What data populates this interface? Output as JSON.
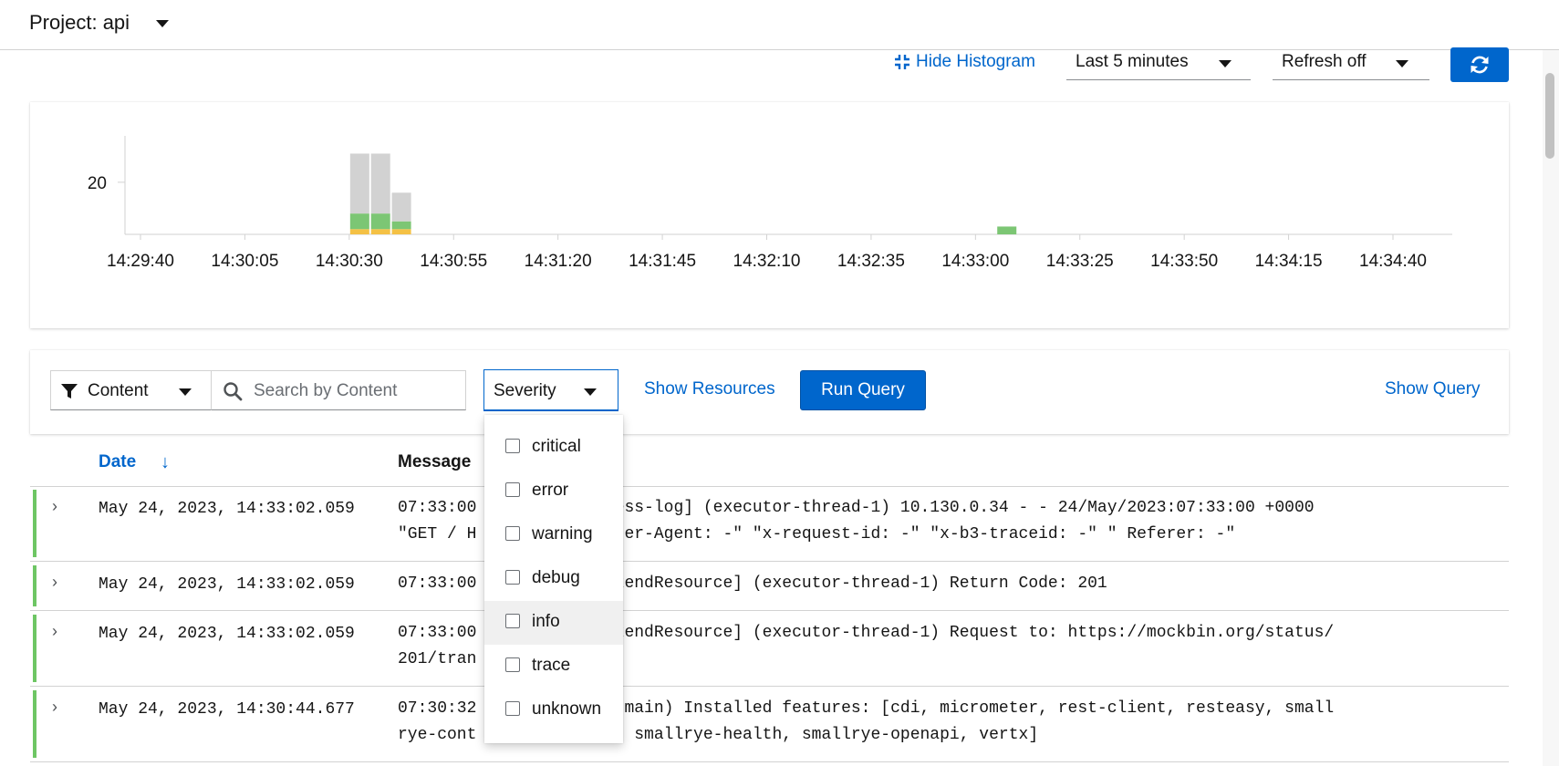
{
  "header": {
    "project_label": "Project: api"
  },
  "toolbar": {
    "hide_histogram_label": "Hide Histogram",
    "time_range_value": "Last 5 minutes",
    "refresh_value": "Refresh off",
    "refresh_icon": "sync-icon"
  },
  "chart_data": {
    "type": "bar",
    "stacked": true,
    "categories": [
      "14:30:30",
      "14:30:35",
      "14:30:40",
      "14:33:05"
    ],
    "series": [
      {
        "name": "",
        "color": "#f4c145",
        "values": [
          2,
          2,
          2,
          0
        ]
      },
      {
        "name": "",
        "color": "#7cc674",
        "values": [
          6,
          6,
          3,
          3
        ]
      },
      {
        "name": "",
        "color": "#d2d2d2",
        "values": [
          23,
          23,
          11,
          0
        ]
      }
    ],
    "y_ticks": [
      20
    ],
    "ylim": [
      0,
      35
    ],
    "x_ticks": [
      "14:29:40",
      "14:30:05",
      "14:30:30",
      "14:30:55",
      "14:31:20",
      "14:31:45",
      "14:32:10",
      "14:32:35",
      "14:33:00",
      "14:33:25",
      "14:33:50",
      "14:34:15",
      "14:34:40"
    ],
    "xlabel": "",
    "ylabel": "",
    "title": ""
  },
  "filter": {
    "attribute_value": "Content",
    "search_placeholder": "Search by Content",
    "severity_label": "Severity",
    "show_resources_label": "Show Resources",
    "run_query_label": "Run Query",
    "show_query_label": "Show Query"
  },
  "severity_options": [
    "critical",
    "error",
    "warning",
    "debug",
    "info",
    "trace",
    "unknown"
  ],
  "table": {
    "headers": {
      "date": "Date",
      "message": "Message"
    },
    "rows": [
      {
        "date": "May 24, 2023, 14:33:02.059",
        "message": "07:33:00 [io.undertow.light.access-log] (executor-thread-1) 10.130.0.34 - - 24/May/2023:07:33:00 +0000\n\"GET / HTTP/1.1\" 200 100 \"User-Agent: -\" \"x-request-id: -\" \"x-b3-traceid: -\" \" Referer: -\"",
        "visible": "07:33:00        ht.access-log] (executor-thread-1) 10.130.0.34 - - 24/May/2023:07:33:00 +0000\n\"GET / H        100 \"User-Agent: -\" \"x-request-id: -\" \"x-b3-traceid: -\" \" Referer: -\""
      },
      {
        "date": "May 24, 2023, 14:33:02.059",
        "message": "07:33:00        qu.BackendResource] (executor-thread-1) Return Code: 201"
      },
      {
        "date": "May 24, 2023, 14:33:02.059",
        "message": "07:33:00        qu.BackendResource] (executor-thread-1) Request to: https://mockbin.org/status/\n201/tran        eted"
      },
      {
        "date": "May 24, 2023, 14:30:44.677",
        "message": "07:30:32        rkus] (main) Installed features: [cdi, micrometer, rest-client, resteasy, small\nrye-cont            on, smallrye-health, smallrye-openapi, vertx]"
      }
    ]
  }
}
